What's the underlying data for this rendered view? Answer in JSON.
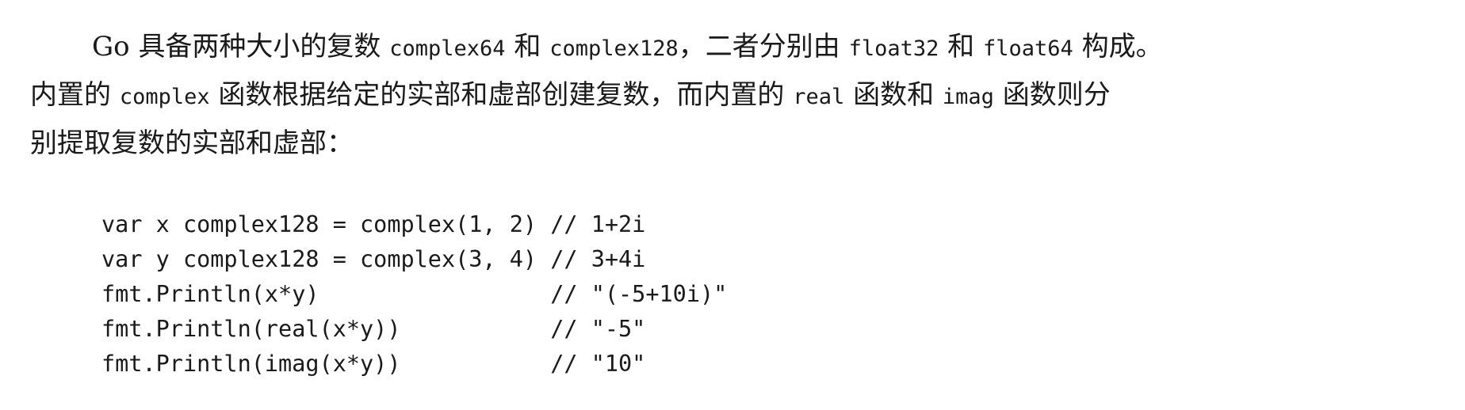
{
  "paragraph": {
    "line1": {
      "t1": "Go 具备两种大小的复数 ",
      "c1": "complex64",
      "t2": " 和 ",
      "c2": "complex128",
      "t3": "，二者分别由 ",
      "c3": "float32",
      "t4": " 和 ",
      "c4": "float64",
      "t5": " 构成。"
    },
    "line2": {
      "t1": "内置的 ",
      "c1": "complex",
      "t2": " 函数根据给定的实部和虚部创建复数，而内置的 ",
      "c2": "real",
      "t3": " 函数和 ",
      "c3": "imag",
      "t4": " 函数则分"
    },
    "line3": {
      "t1": "别提取复数的实部和虚部："
    }
  },
  "code_block": {
    "lines": [
      "var x complex128 = complex(1, 2) // 1+2i",
      "var y complex128 = complex(3, 4) // 3+4i",
      "fmt.Println(x*y)                 // \"(-5+10i)\"",
      "fmt.Println(real(x*y))           // \"-5\"",
      "fmt.Println(imag(x*y))           // \"10\""
    ]
  }
}
